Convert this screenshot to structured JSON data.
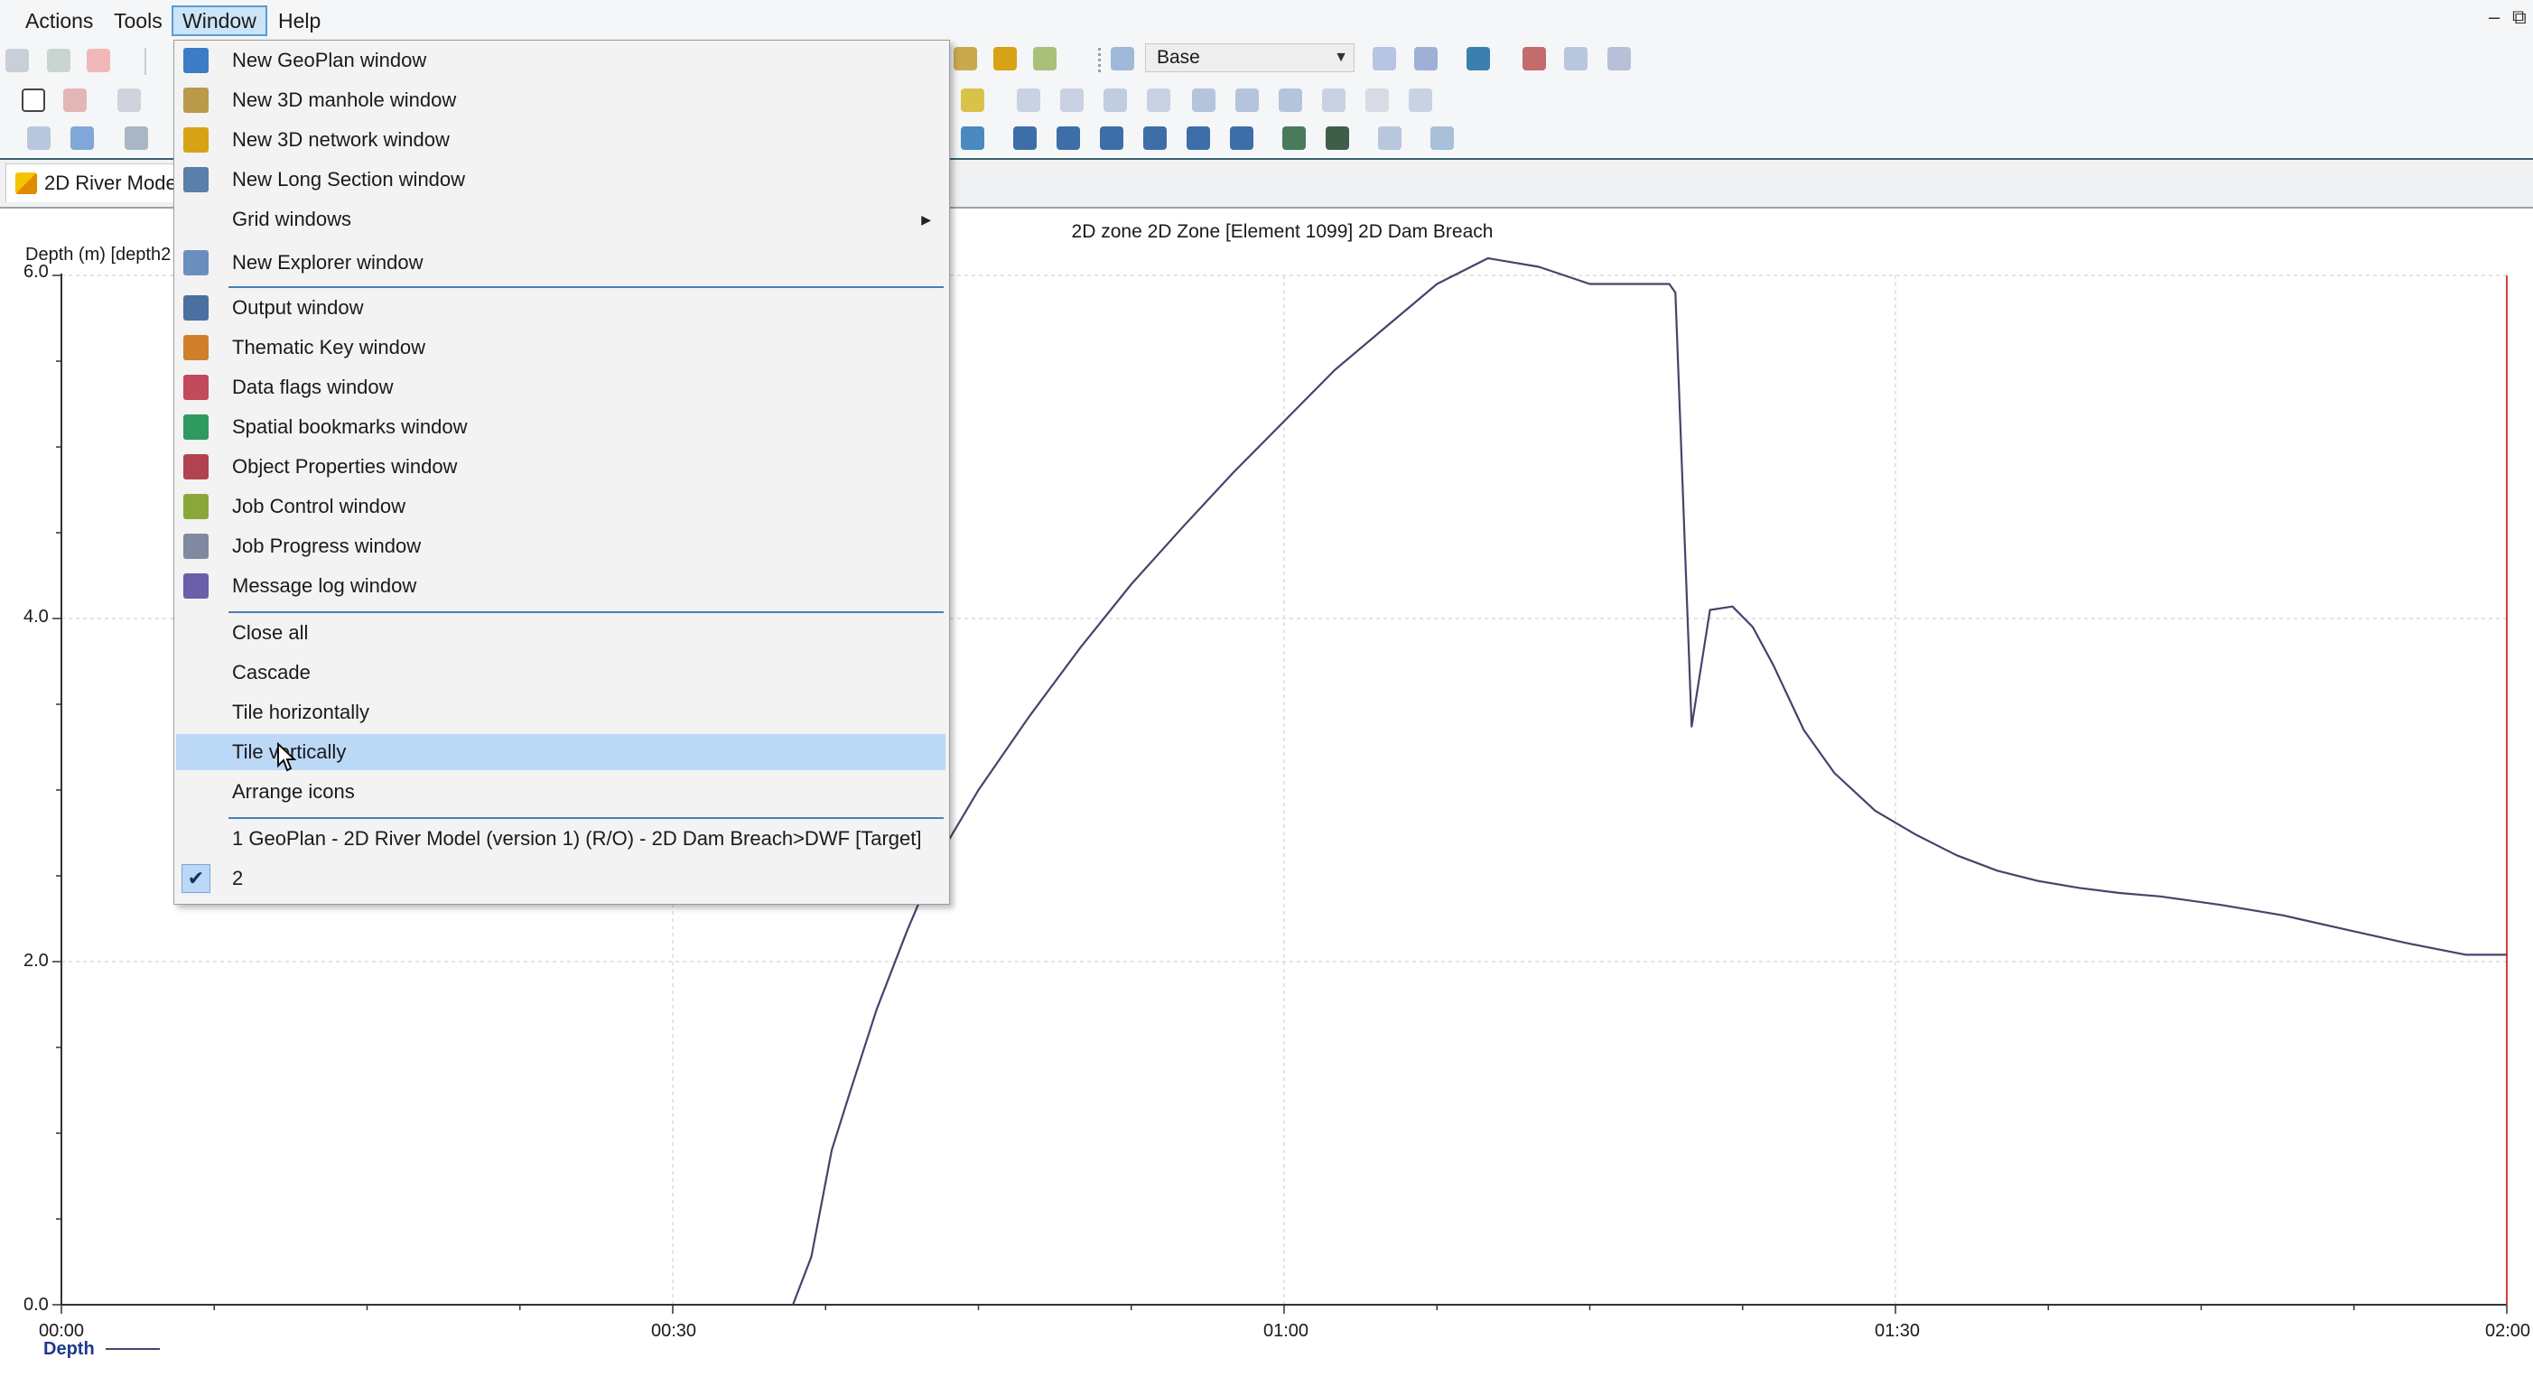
{
  "menubar": {
    "items": [
      "Actions",
      "Tools",
      "Window",
      "Help"
    ],
    "active_index": 2,
    "window_buttons": [
      "–",
      "⧉"
    ]
  },
  "toolbar": {
    "scenario_select": "Base"
  },
  "document_tab": {
    "label": "2D River Model"
  },
  "window_menu": {
    "items": [
      {
        "label": "New GeoPlan window",
        "icon": "geoplan-icon",
        "color": "#3d7bc4"
      },
      {
        "label": "New 3D manhole window",
        "icon": "manhole-3d-icon",
        "color": "#b89a4a"
      },
      {
        "label": "New 3D network window",
        "icon": "network-3d-icon",
        "color": "#d8a216"
      },
      {
        "label": "New Long Section window",
        "icon": "long-section-icon",
        "color": "#5a7fa8"
      },
      {
        "label": "Grid windows",
        "submenu": true
      },
      {
        "label": "New Explorer window",
        "icon": "explorer-icon",
        "color": "#6a8fbf"
      },
      {
        "label": "Output window",
        "icon": "output-icon",
        "color": "#4a6fa0"
      },
      {
        "label": "Thematic Key window",
        "icon": "thematic-key-icon",
        "color": "#d0802a"
      },
      {
        "label": "Data flags window",
        "icon": "data-flags-icon",
        "color": "#c24a5a"
      },
      {
        "label": "Spatial bookmarks window",
        "icon": "spatial-bookmarks-icon",
        "color": "#2f9a5f"
      },
      {
        "label": "Object Properties window",
        "icon": "object-properties-icon",
        "color": "#b0434f"
      },
      {
        "label": "Job Control window",
        "icon": "job-control-icon",
        "color": "#8aa83a"
      },
      {
        "label": "Job Progress window",
        "icon": "job-progress-icon",
        "color": "#7f8aa0"
      },
      {
        "label": "Message log window",
        "icon": "message-log-icon",
        "color": "#6a5fa8"
      },
      {
        "label": "Close all"
      },
      {
        "label": "Cascade"
      },
      {
        "label": "Tile horizontally"
      },
      {
        "label": "Tile vertically",
        "highlighted": true
      },
      {
        "label": "Arrange icons"
      },
      {
        "label": "1 GeoPlan - 2D River Model (version 1) (R/O) - 2D Dam Breach>DWF  [Target]"
      },
      {
        "label": "2",
        "checked": true
      }
    ],
    "checkmark": "✔"
  },
  "chart_data": {
    "type": "line",
    "title": "2D zone 2D Zone [Element 1099] 2D Dam Breach",
    "ylabel": "Depth (m) [depth2",
    "ylim": [
      0,
      6
    ],
    "yticks": [
      "0.0",
      "2.0",
      "4.0",
      "6.0"
    ],
    "xlim_minutes": [
      0,
      120
    ],
    "xticks": [
      "00:00",
      "00:30",
      "01:00",
      "01:30",
      "02:00"
    ],
    "grid": true,
    "legend": "bottom-left",
    "series": [
      {
        "name": "Depth",
        "color": "#43456a",
        "x": [
          35.9,
          36.8,
          37.8,
          38.7,
          40.0,
          41.5,
          43.0,
          45.0,
          47.5,
          50.0,
          52.5,
          55.0,
          57.5,
          60.0,
          62.5,
          65.0,
          67.5,
          70.0,
          72.5,
          75.0,
          77.5,
          78.9,
          79.2,
          80.0,
          80.9,
          82.0,
          83.0,
          84.0,
          85.5,
          87.0,
          89.0,
          91.0,
          93.0,
          95.0,
          97.0,
          99.0,
          101.0,
          103.0,
          106.0,
          109.0,
          112.0,
          115.0,
          118.0,
          120.0
        ],
        "y": [
          0.0,
          0.28,
          0.9,
          1.24,
          1.72,
          2.18,
          2.6,
          3.0,
          3.43,
          3.83,
          4.2,
          4.53,
          4.85,
          5.15,
          5.45,
          5.7,
          5.95,
          6.1,
          6.05,
          5.95,
          5.95,
          5.95,
          5.9,
          3.37,
          4.05,
          4.07,
          3.95,
          3.73,
          3.35,
          3.1,
          2.88,
          2.74,
          2.62,
          2.53,
          2.47,
          2.43,
          2.4,
          2.38,
          2.33,
          2.27,
          2.19,
          2.11,
          2.04,
          2.04
        ]
      }
    ]
  }
}
